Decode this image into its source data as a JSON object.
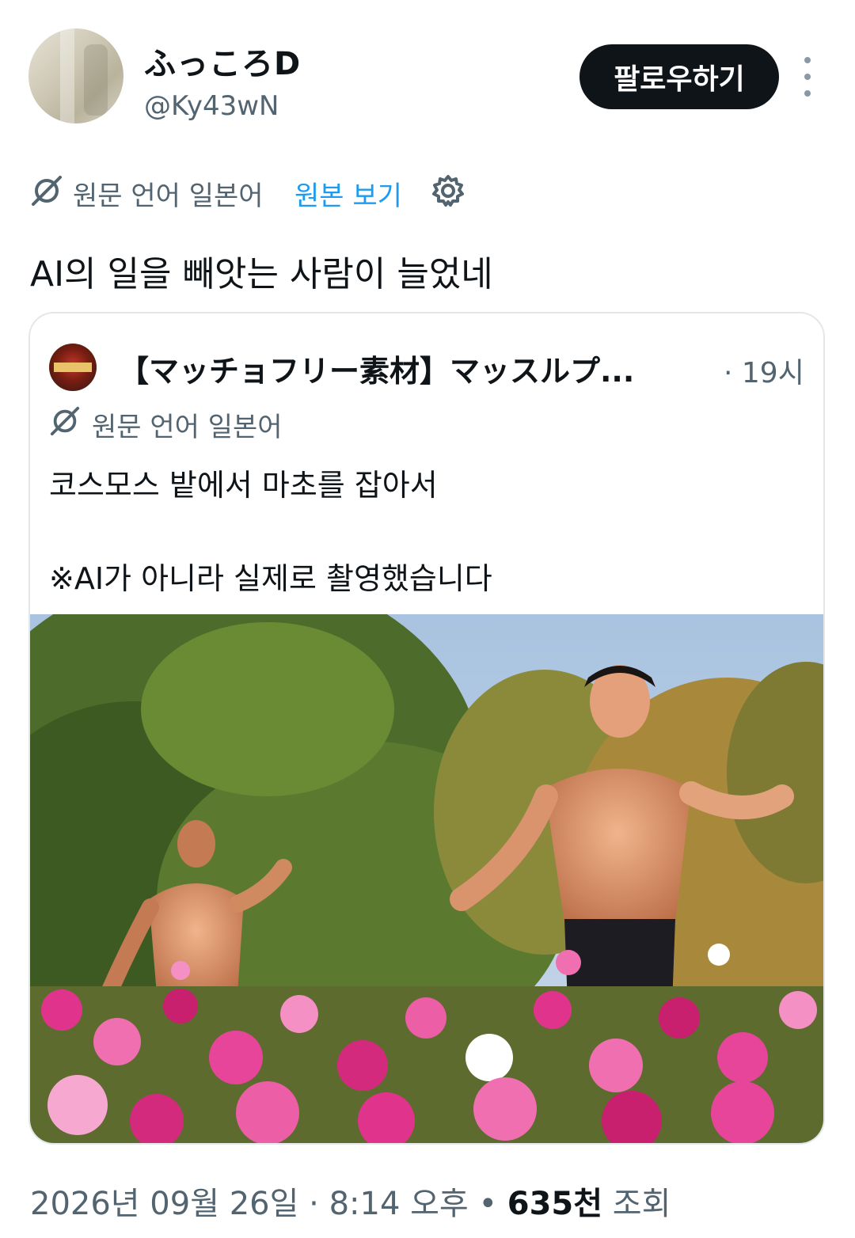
{
  "author": {
    "display_name": "ふっころD",
    "handle": "@Ky43wN",
    "follow_label": "팔로우하기"
  },
  "translation": {
    "source_language": "원문 언어 일본어",
    "view_original": "원본 보기"
  },
  "tweet": {
    "text": "AI의 일을 빼앗는 사람이 늘었네"
  },
  "quote": {
    "display_name": "【マッチョフリー素材】マッスルプ...",
    "time": "· 19시",
    "source_language": "원문 언어 일본어",
    "line1": "코스모스 밭에서 마초를 잡아서",
    "line2": "※AI가 아니라 실제로 촬영했습니다"
  },
  "footer": {
    "date": "2026년 09월 26일",
    "time": "· 8:14 오후",
    "views_count": "635천",
    "views_label": "조회"
  },
  "colors": {
    "text_primary": "#0f1419",
    "text_secondary": "#536471",
    "link": "#1d9bf0",
    "button_bg": "#0f1419"
  }
}
